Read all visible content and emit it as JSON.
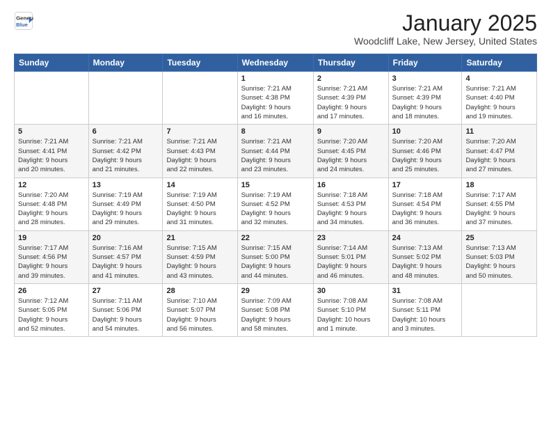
{
  "header": {
    "logo_general": "General",
    "logo_blue": "Blue",
    "month_title": "January 2025",
    "subtitle": "Woodcliff Lake, New Jersey, United States"
  },
  "weekdays": [
    "Sunday",
    "Monday",
    "Tuesday",
    "Wednesday",
    "Thursday",
    "Friday",
    "Saturday"
  ],
  "weeks": [
    [
      {
        "day": "",
        "detail": ""
      },
      {
        "day": "",
        "detail": ""
      },
      {
        "day": "",
        "detail": ""
      },
      {
        "day": "1",
        "detail": "Sunrise: 7:21 AM\nSunset: 4:38 PM\nDaylight: 9 hours\nand 16 minutes."
      },
      {
        "day": "2",
        "detail": "Sunrise: 7:21 AM\nSunset: 4:39 PM\nDaylight: 9 hours\nand 17 minutes."
      },
      {
        "day": "3",
        "detail": "Sunrise: 7:21 AM\nSunset: 4:39 PM\nDaylight: 9 hours\nand 18 minutes."
      },
      {
        "day": "4",
        "detail": "Sunrise: 7:21 AM\nSunset: 4:40 PM\nDaylight: 9 hours\nand 19 minutes."
      }
    ],
    [
      {
        "day": "5",
        "detail": "Sunrise: 7:21 AM\nSunset: 4:41 PM\nDaylight: 9 hours\nand 20 minutes."
      },
      {
        "day": "6",
        "detail": "Sunrise: 7:21 AM\nSunset: 4:42 PM\nDaylight: 9 hours\nand 21 minutes."
      },
      {
        "day": "7",
        "detail": "Sunrise: 7:21 AM\nSunset: 4:43 PM\nDaylight: 9 hours\nand 22 minutes."
      },
      {
        "day": "8",
        "detail": "Sunrise: 7:21 AM\nSunset: 4:44 PM\nDaylight: 9 hours\nand 23 minutes."
      },
      {
        "day": "9",
        "detail": "Sunrise: 7:20 AM\nSunset: 4:45 PM\nDaylight: 9 hours\nand 24 minutes."
      },
      {
        "day": "10",
        "detail": "Sunrise: 7:20 AM\nSunset: 4:46 PM\nDaylight: 9 hours\nand 25 minutes."
      },
      {
        "day": "11",
        "detail": "Sunrise: 7:20 AM\nSunset: 4:47 PM\nDaylight: 9 hours\nand 27 minutes."
      }
    ],
    [
      {
        "day": "12",
        "detail": "Sunrise: 7:20 AM\nSunset: 4:48 PM\nDaylight: 9 hours\nand 28 minutes."
      },
      {
        "day": "13",
        "detail": "Sunrise: 7:19 AM\nSunset: 4:49 PM\nDaylight: 9 hours\nand 29 minutes."
      },
      {
        "day": "14",
        "detail": "Sunrise: 7:19 AM\nSunset: 4:50 PM\nDaylight: 9 hours\nand 31 minutes."
      },
      {
        "day": "15",
        "detail": "Sunrise: 7:19 AM\nSunset: 4:52 PM\nDaylight: 9 hours\nand 32 minutes."
      },
      {
        "day": "16",
        "detail": "Sunrise: 7:18 AM\nSunset: 4:53 PM\nDaylight: 9 hours\nand 34 minutes."
      },
      {
        "day": "17",
        "detail": "Sunrise: 7:18 AM\nSunset: 4:54 PM\nDaylight: 9 hours\nand 36 minutes."
      },
      {
        "day": "18",
        "detail": "Sunrise: 7:17 AM\nSunset: 4:55 PM\nDaylight: 9 hours\nand 37 minutes."
      }
    ],
    [
      {
        "day": "19",
        "detail": "Sunrise: 7:17 AM\nSunset: 4:56 PM\nDaylight: 9 hours\nand 39 minutes."
      },
      {
        "day": "20",
        "detail": "Sunrise: 7:16 AM\nSunset: 4:57 PM\nDaylight: 9 hours\nand 41 minutes."
      },
      {
        "day": "21",
        "detail": "Sunrise: 7:15 AM\nSunset: 4:59 PM\nDaylight: 9 hours\nand 43 minutes."
      },
      {
        "day": "22",
        "detail": "Sunrise: 7:15 AM\nSunset: 5:00 PM\nDaylight: 9 hours\nand 44 minutes."
      },
      {
        "day": "23",
        "detail": "Sunrise: 7:14 AM\nSunset: 5:01 PM\nDaylight: 9 hours\nand 46 minutes."
      },
      {
        "day": "24",
        "detail": "Sunrise: 7:13 AM\nSunset: 5:02 PM\nDaylight: 9 hours\nand 48 minutes."
      },
      {
        "day": "25",
        "detail": "Sunrise: 7:13 AM\nSunset: 5:03 PM\nDaylight: 9 hours\nand 50 minutes."
      }
    ],
    [
      {
        "day": "26",
        "detail": "Sunrise: 7:12 AM\nSunset: 5:05 PM\nDaylight: 9 hours\nand 52 minutes."
      },
      {
        "day": "27",
        "detail": "Sunrise: 7:11 AM\nSunset: 5:06 PM\nDaylight: 9 hours\nand 54 minutes."
      },
      {
        "day": "28",
        "detail": "Sunrise: 7:10 AM\nSunset: 5:07 PM\nDaylight: 9 hours\nand 56 minutes."
      },
      {
        "day": "29",
        "detail": "Sunrise: 7:09 AM\nSunset: 5:08 PM\nDaylight: 9 hours\nand 58 minutes."
      },
      {
        "day": "30",
        "detail": "Sunrise: 7:08 AM\nSunset: 5:10 PM\nDaylight: 10 hours\nand 1 minute."
      },
      {
        "day": "31",
        "detail": "Sunrise: 7:08 AM\nSunset: 5:11 PM\nDaylight: 10 hours\nand 3 minutes."
      },
      {
        "day": "",
        "detail": ""
      }
    ]
  ]
}
